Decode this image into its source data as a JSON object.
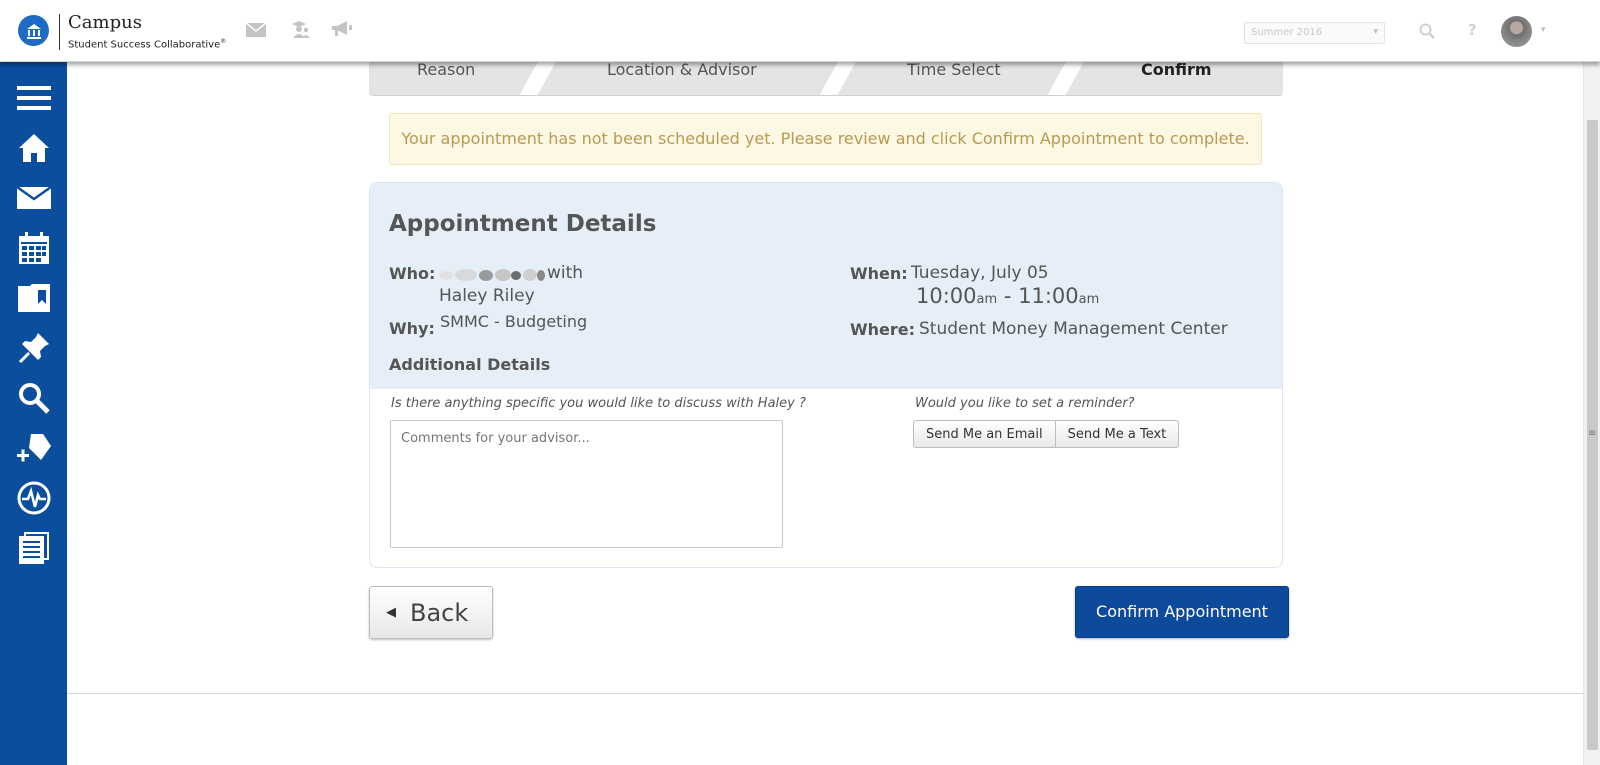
{
  "header": {
    "brand_title": "Campus",
    "brand_subtitle": "Student Success Collaborative",
    "trademark": "®",
    "term_selected": "Summer 2016"
  },
  "sidebar": {
    "items": [
      {
        "name": "menu-icon"
      },
      {
        "name": "home-icon"
      },
      {
        "name": "mail-icon"
      },
      {
        "name": "calendar-icon"
      },
      {
        "name": "folder-icon"
      },
      {
        "name": "pin-icon"
      },
      {
        "name": "search-icon"
      },
      {
        "name": "add-tag-icon"
      },
      {
        "name": "activity-icon"
      },
      {
        "name": "notes-icon"
      }
    ]
  },
  "steps": [
    {
      "label": "Reason",
      "active": false
    },
    {
      "label": "Location & Advisor",
      "active": false
    },
    {
      "label": "Time Select",
      "active": false
    },
    {
      "label": "Confirm",
      "active": true
    }
  ],
  "alert": {
    "message": "Your appointment has not been scheduled yet. Please review and click Confirm Appointment to complete."
  },
  "details": {
    "title": "Appointment Details",
    "who_label": "Who:",
    "who_with": "with",
    "advisor": "Haley Riley",
    "why_label": "Why:",
    "why_value": "SMMC - Budgeting",
    "when_label": "When:",
    "date": "Tuesday, July 05",
    "start_time": "10:00",
    "start_ampm": "am",
    "time_sep": " - ",
    "end_time": "11:00",
    "end_ampm": "am",
    "where_label": "Where:",
    "where_value": "Student Money Management Center",
    "additional_title": "Additional Details",
    "discuss_question": "Is there anything specific you would like to discuss with Haley ?",
    "comments_placeholder": "Comments for your advisor...",
    "reminder_question": "Would you like to set a reminder?",
    "email_button": "Send Me an Email",
    "text_button": "Send Me a Text"
  },
  "actions": {
    "back": "Back",
    "confirm": "Confirm Appointment"
  },
  "colors": {
    "nav_blue": "#0b4e9e",
    "confirm_blue": "#0e4a9c",
    "alert_bg": "#fcf8e3",
    "alert_text": "#b89a52",
    "card_bg": "#e6eff7"
  }
}
